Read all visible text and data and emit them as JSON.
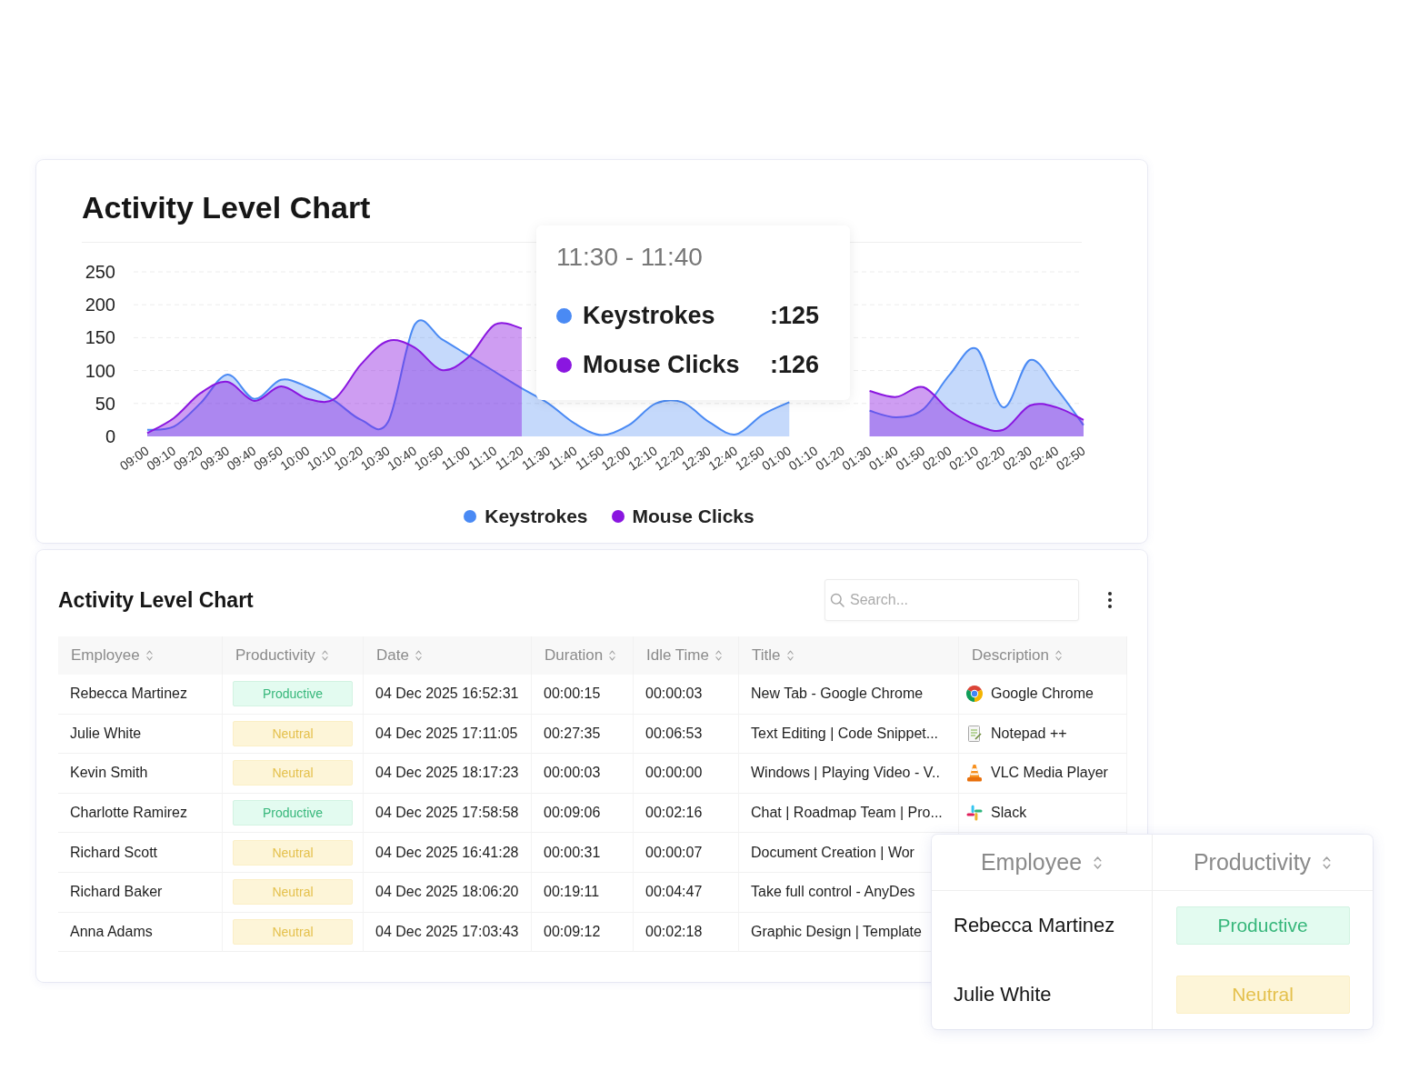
{
  "chart_card": {
    "title": "Activity Level Chart",
    "chart_data": {
      "type": "area",
      "grid": true,
      "legend": "bottom",
      "categories": [
        "09:00",
        "09:10",
        "09:20",
        "09:30",
        "09:40",
        "09:50",
        "10:00",
        "10:10",
        "10:20",
        "10:30",
        "10:40",
        "10:50",
        "11:00",
        "11:10",
        "11:20",
        "11:30",
        "11:40",
        "11:50",
        "12:00",
        "12:10",
        "12:20",
        "12:30",
        "12:40",
        "12:50",
        "01:00",
        "01:10",
        "01:20",
        "01:30",
        "01:40",
        "01:50",
        "02:00",
        "02:10",
        "02:20",
        "02:30",
        "02:40",
        "02:50"
      ],
      "ylim": [
        0,
        250
      ],
      "yticks": [
        0,
        50,
        100,
        150,
        200,
        250
      ],
      "series": [
        {
          "name": "Keystrokes",
          "color": "#4a8af4",
          "values": [
            10,
            15,
            51,
            94,
            57,
            86,
            75,
            54,
            25,
            22,
            170,
            148,
            123,
            98,
            73,
            50,
            19,
            2,
            17,
            50,
            52,
            22,
            3,
            33,
            52,
            null,
            null,
            39,
            29,
            41,
            94,
            133,
            44,
            116,
            72,
            17
          ]
        },
        {
          "name": "Mouse Clicks",
          "color": "#8a16e0",
          "values": [
            5,
            28,
            66,
            83,
            54,
            76,
            57,
            57,
            110,
            145,
            135,
            101,
            120,
            170,
            164,
            null,
            null,
            null,
            null,
            null,
            null,
            null,
            null,
            null,
            null,
            null,
            null,
            69,
            60,
            75,
            39,
            17,
            10,
            47,
            44,
            25
          ]
        }
      ]
    },
    "tooltip": {
      "range": "11:30 - 11:40",
      "items": [
        {
          "label": "Keystrokes",
          "value": ":125",
          "color": "#4a8af4"
        },
        {
          "label": "Mouse Clicks",
          "value": ":126",
          "color": "#8a16e0"
        }
      ]
    }
  },
  "table_card": {
    "title": "Activity Level Chart",
    "search": {
      "placeholder": "Search..."
    },
    "table": {
      "columns": [
        "Employee",
        "Productivity",
        "Date",
        "Duration",
        "Idle Time",
        "Title",
        "Description"
      ],
      "rows": [
        {
          "employee": "Rebecca Martinez",
          "productivity": {
            "label": "Productive",
            "kind": "productive"
          },
          "date": "04 Dec 2025 16:52:31",
          "duration": "00:00:15",
          "idle_time": "00:00:03",
          "title": "New Tab - Google Chrome",
          "description": {
            "name": "Google Chrome",
            "kind": "browser"
          }
        },
        {
          "employee": "Julie White",
          "productivity": {
            "label": "Neutral",
            "kind": "neutral"
          },
          "date": "04 Dec 2025 17:11:05",
          "duration": "00:27:35",
          "idle_time": "00:06:53",
          "title": "Text Editing | Code Snippet...",
          "description": {
            "name": "Notepad ++",
            "kind": "editor"
          }
        },
        {
          "employee": "Kevin Smith",
          "productivity": {
            "label": "Neutral",
            "kind": "neutral"
          },
          "date": "04 Dec 2025 18:17:23",
          "duration": "00:00:03",
          "idle_time": "00:00:00",
          "title": "Windows | Playing Video - V..",
          "description": {
            "name": "VLC Media Player",
            "kind": "player"
          }
        },
        {
          "employee": "Charlotte Ramirez",
          "productivity": {
            "label": "Productive",
            "kind": "productive"
          },
          "date": "04 Dec 2025 17:58:58",
          "duration": "00:09:06",
          "idle_time": "00:02:16",
          "title": "Chat | Roadmap Team | Pro...",
          "description": {
            "name": "Slack",
            "kind": "chat"
          }
        },
        {
          "employee": "Richard Scott",
          "productivity": {
            "label": "Neutral",
            "kind": "neutral"
          },
          "date": "04 Dec 2025 16:41:28",
          "duration": "00:00:31",
          "idle_time": "00:00:07",
          "title": "Document Creation | Wor"
        },
        {
          "employee": "Richard Baker",
          "productivity": {
            "label": "Neutral",
            "kind": "neutral"
          },
          "date": "04 Dec 2025 18:06:20",
          "duration": "00:19:11",
          "idle_time": "00:04:47",
          "title": "Take full control - AnyDes"
        },
        {
          "employee": "Anna Adams",
          "productivity": {
            "label": "Neutral",
            "kind": "neutral"
          },
          "date": "04 Dec 2025 17:03:43",
          "duration": "00:09:12",
          "idle_time": "00:02:18",
          "title": "Graphic Design | Template"
        }
      ]
    }
  },
  "zoom_panel": {
    "columns": [
      "Employee",
      "Productivity"
    ],
    "rows": [
      {
        "employee": "Rebecca Martinez",
        "productivity": {
          "label": "Productive",
          "kind": "productive"
        }
      },
      {
        "employee": "Julie White",
        "productivity": {
          "label": "Neutral",
          "kind": "neutral"
        }
      }
    ]
  }
}
